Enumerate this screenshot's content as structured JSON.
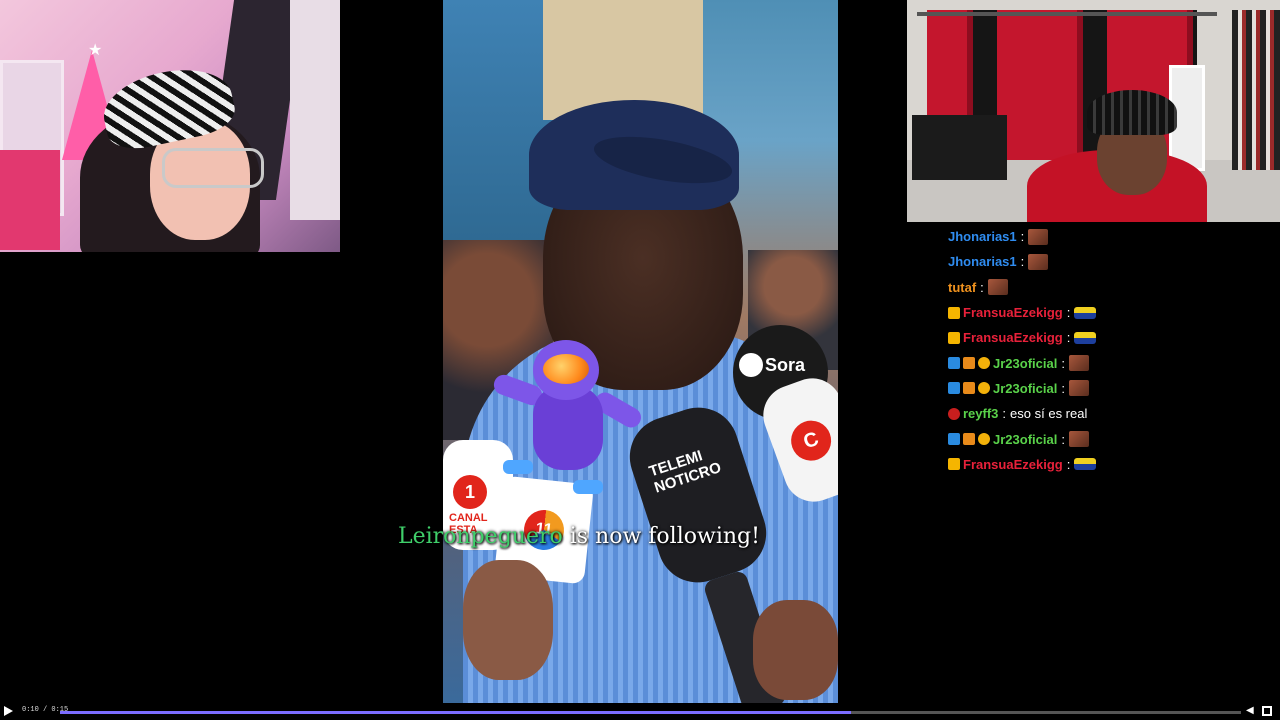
{
  "video": {
    "watermark": "Sora",
    "mic_labels": {
      "telemicro": "TELEMI NOTICRO",
      "canal": "CANAL ESTA",
      "canal_num": "1",
      "eleven": "11",
      "right": "C"
    }
  },
  "alert": {
    "username": "Leironpeguero",
    "message": " is now following!"
  },
  "chat": {
    "messages": [
      {
        "badges": [],
        "user": "Jhonarias1",
        "color": "#2f8cf0",
        "emote": "face",
        "text": ""
      },
      {
        "badges": [],
        "user": "Jhonarias1",
        "color": "#2f8cf0",
        "emote": "face",
        "text": ""
      },
      {
        "badges": [],
        "user": "tutaf",
        "color": "#f0921e",
        "emote": "face",
        "text": ""
      },
      {
        "badges": [
          "crown"
        ],
        "user": "FransuaEzekigg",
        "color": "#e8213a",
        "emote": "car",
        "text": ""
      },
      {
        "badges": [
          "crown"
        ],
        "user": "FransuaEzekigg",
        "color": "#e8213a",
        "emote": "car",
        "text": ""
      },
      {
        "badges": [
          "arrow",
          "cube",
          "one"
        ],
        "user": "Jr23oficial",
        "color": "#5ad24a",
        "emote": "face",
        "text": ""
      },
      {
        "badges": [
          "arrow",
          "cube",
          "one"
        ],
        "user": "Jr23oficial",
        "color": "#5ad24a",
        "emote": "face",
        "text": ""
      },
      {
        "badges": [
          "dot"
        ],
        "user": "reyff3",
        "color": "#5ad24a",
        "emote": "",
        "text": "eso sí es real"
      },
      {
        "badges": [
          "arrow",
          "cube",
          "one"
        ],
        "user": "Jr23oficial",
        "color": "#5ad24a",
        "emote": "face",
        "text": ""
      },
      {
        "badges": [
          "crown"
        ],
        "user": "FransuaEzekigg",
        "color": "#e8213a",
        "emote": "car",
        "text": ""
      }
    ]
  },
  "player": {
    "time": "0:10 / 0:15",
    "progress": 0.67,
    "accent": "#7b6cff"
  }
}
